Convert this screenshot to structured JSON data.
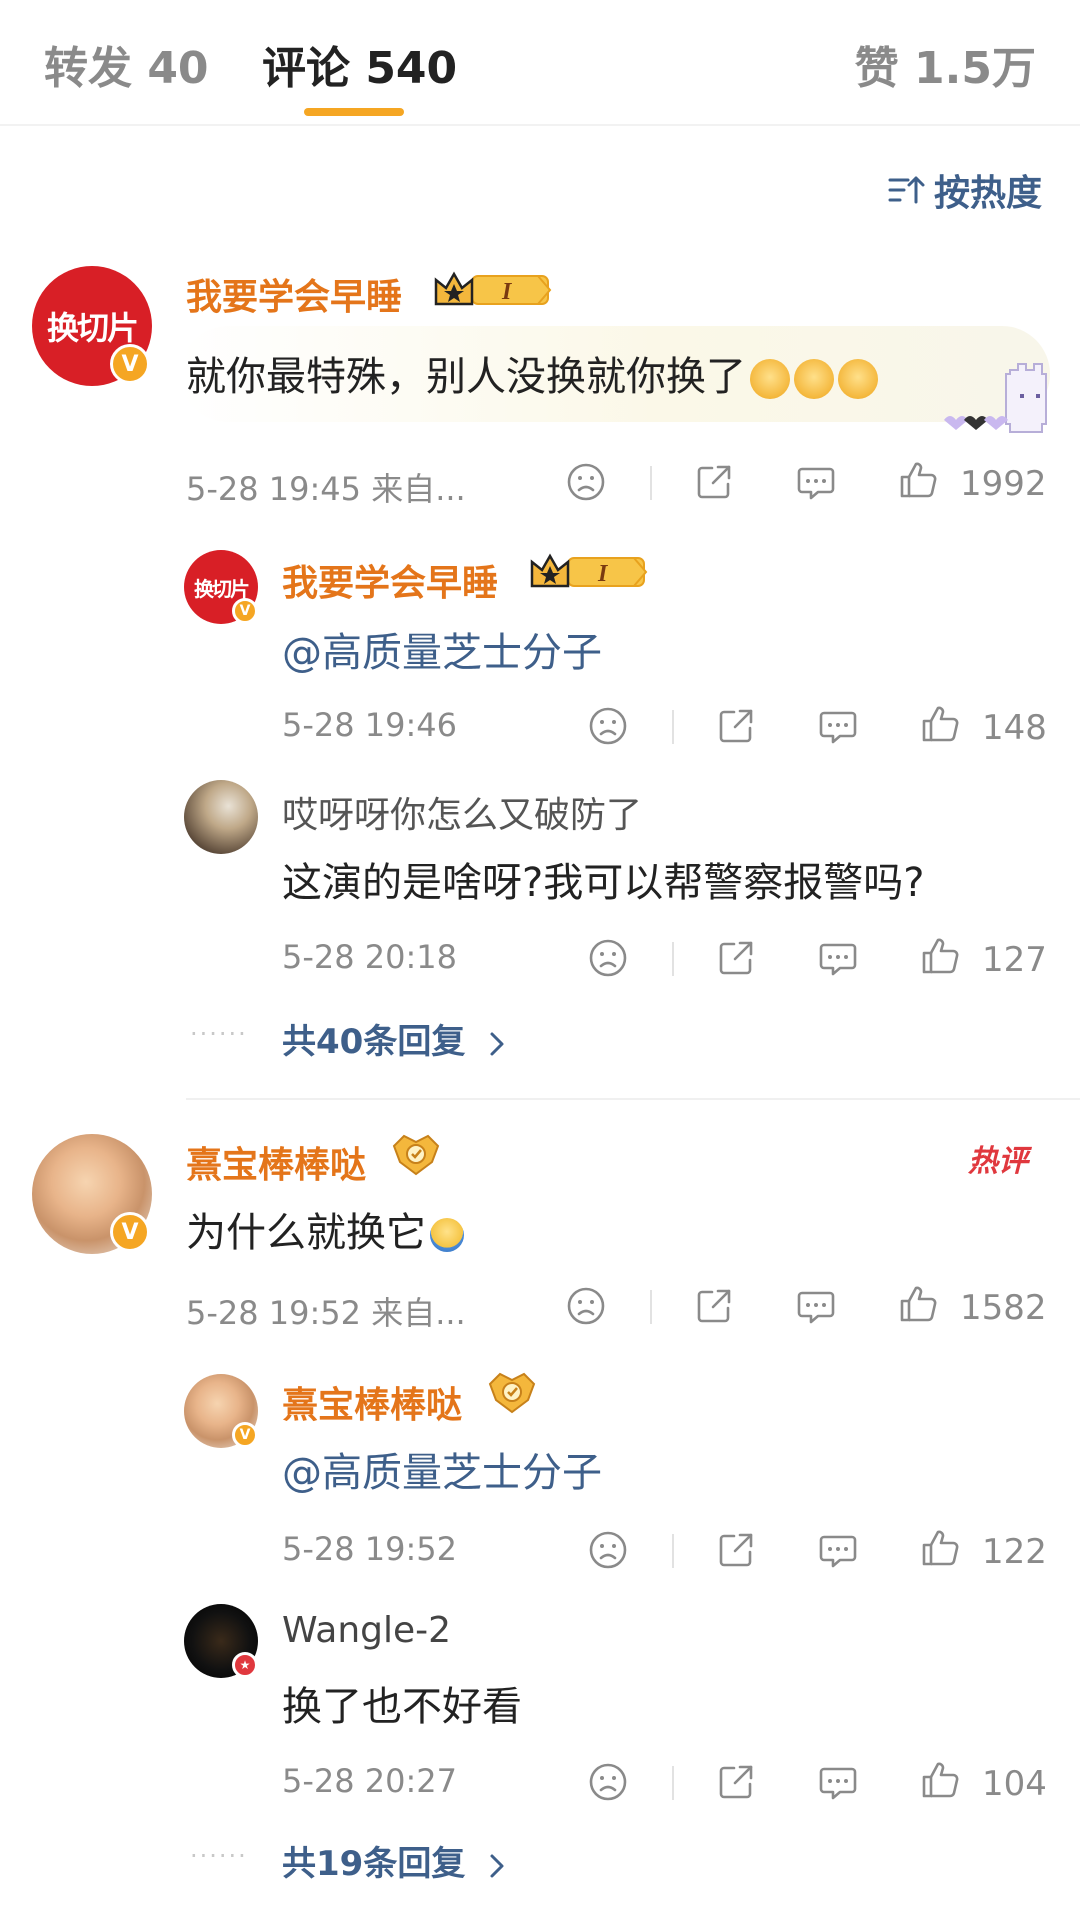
{
  "tabs": {
    "repost": "转发 40",
    "comment": "评论 540",
    "like": "赞 1.5万"
  },
  "sort": {
    "label": "按热度",
    "icon": "sort-icon"
  },
  "comments": [
    {
      "avatar_text": "换切片",
      "name": "我要学会早睡",
      "text": "就你最特殊，别人没换就你换了",
      "emoji_icons": [
        "dog-face-emoji",
        "dog-face-emoji",
        "dog-face-emoji"
      ],
      "time": "5-28 19:45 来自...",
      "likes": "1992",
      "replies": [
        {
          "avatar_text": "换切片",
          "name": "我要学会早睡",
          "text": "@高质量芝士分子",
          "time": "5-28 19:46",
          "likes": "148"
        },
        {
          "name": "哎呀呀你怎么又破防了",
          "text": "这演的是啥呀?我可以帮警察报警吗?",
          "time": "5-28 20:18",
          "likes": "127"
        }
      ],
      "more_replies": "共40条回复"
    },
    {
      "name": "熹宝棒棒哒",
      "hot_tag": "热评",
      "text": "为什么就换它",
      "time": "5-28 19:52 来自...",
      "likes": "1582",
      "replies": [
        {
          "name": "熹宝棒棒哒",
          "text": "@高质量芝士分子",
          "time": "5-28 19:52",
          "likes": "122"
        },
        {
          "name": "Wangle-2",
          "text": "换了也不好看",
          "time": "5-28 20:27",
          "likes": "104"
        }
      ],
      "more_replies": "共19条回复"
    }
  ],
  "colors": {
    "accent_orange": "#f5a623",
    "name_orange": "#e4751a",
    "link_blue": "#3e5f8a",
    "meta_gray": "#8a8a8a",
    "hot_red": "#e0383e"
  }
}
